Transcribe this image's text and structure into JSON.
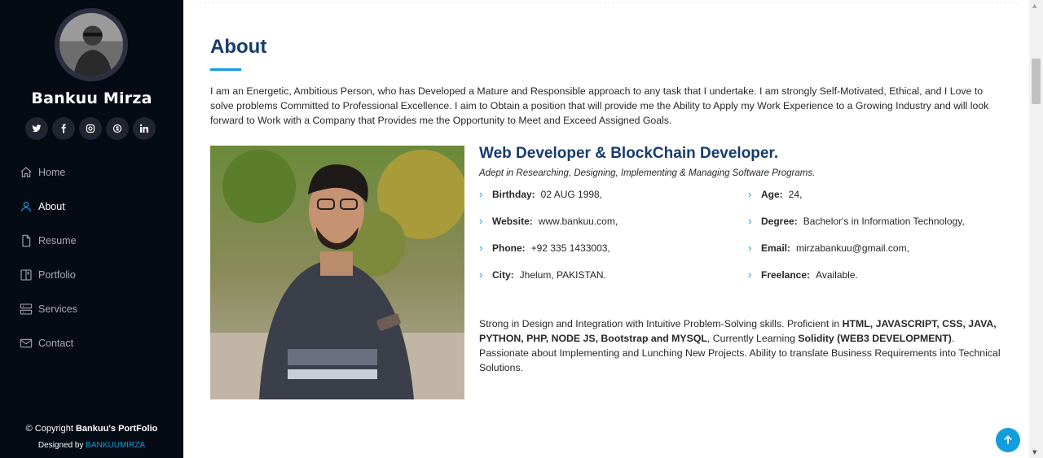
{
  "profile": {
    "name": "Bankuu Mirza",
    "socials": [
      {
        "icon": "twitter-icon"
      },
      {
        "icon": "facebook-icon"
      },
      {
        "icon": "instagram-icon"
      },
      {
        "icon": "skype-icon"
      },
      {
        "icon": "linkedin-icon"
      }
    ]
  },
  "nav": {
    "items": [
      {
        "label": "Home",
        "icon": "home-icon",
        "active": false
      },
      {
        "label": "About",
        "icon": "person-icon",
        "active": true
      },
      {
        "label": "Resume",
        "icon": "file-icon",
        "active": false
      },
      {
        "label": "Portfolio",
        "icon": "book-icon",
        "active": false
      },
      {
        "label": "Services",
        "icon": "server-icon",
        "active": false
      },
      {
        "label": "Contact",
        "icon": "envelope-icon",
        "active": false
      }
    ]
  },
  "footer": {
    "copyright_prefix": "© Copyright",
    "copyright_name": "Bankuu's PortFolio",
    "designed_prefix": "Designed by",
    "designed_link": "BANKUUMIRZA"
  },
  "about": {
    "title": "About",
    "intro": "I am an Energetic, Ambitious Person, who has Developed a Mature and Responsible approach to any task that I undertake. I am strongly Self-Motivated, Ethical, and I Love to solve problems Committed to Professional Excellence. I aim to Obtain a position that will provide me the Ability to Apply my Work Experience to a Growing Industry and will look forward to Work with a Company that Provides me the Opportunity to Meet and Exceed Assigned Goals.",
    "role": "Web Developer & BlockChain Developer.",
    "tagline": "Adept in Researching, Designing, Implementing & Managing Software Programs.",
    "facts_left": [
      {
        "label": "Birthday:",
        "value": "02 AUG 1998,"
      },
      {
        "label": "Website:",
        "value": "www.bankuu.com,"
      },
      {
        "label": "Phone:",
        "value": "+92 335 1433003,"
      },
      {
        "label": "City:",
        "value": "Jhelum, PAKISTAN."
      }
    ],
    "facts_right": [
      {
        "label": "Age:",
        "value": "24,"
      },
      {
        "label": "Degree:",
        "value": "Bachelor's in Information Technology,"
      },
      {
        "label": "Email:",
        "value": "mirzabankuu@gmail.com,"
      },
      {
        "label": "Freelance:",
        "value": "Available."
      }
    ],
    "description": {
      "t1": "Strong in Design and Integration with Intuitive Problem-Solving skills. Proficient in ",
      "b1": "HTML, JAVASCRIPT, CSS, JAVA, PYTHON, PHP, NODE JS, Bootstrap and MYSQL",
      "t2": ", Currently Learning ",
      "b2": "Solidity (WEB3 DEVELOPMENT)",
      "t3": ". Passionate about Implementing and Lunching New Projects. Ability to translate Business Requirements into Technical Solutions."
    }
  },
  "colors": {
    "accent": "#149ddd",
    "sidebar_bg": "#040b14",
    "heading": "#173b6c"
  }
}
